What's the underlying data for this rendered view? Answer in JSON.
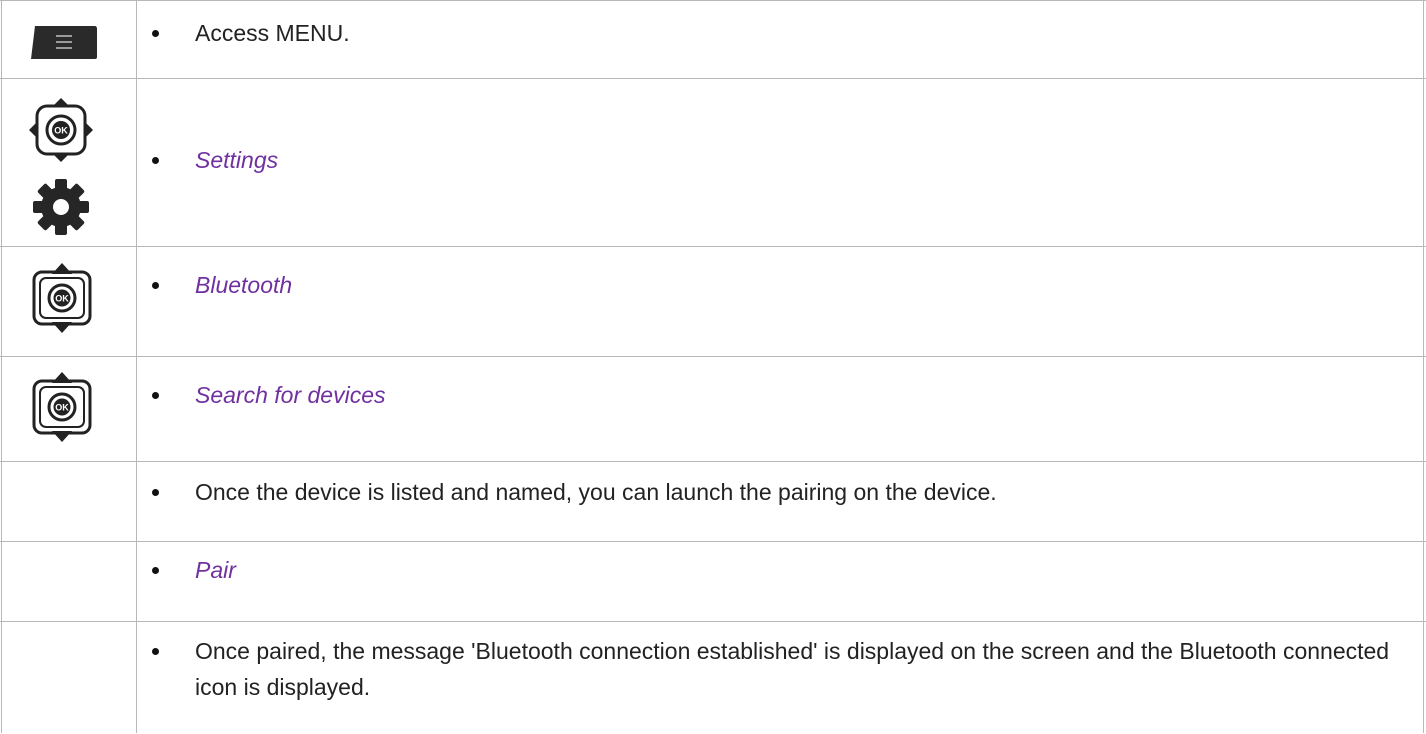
{
  "steps": [
    {
      "text": "Access MENU.",
      "icons": [
        "menu-key-icon"
      ],
      "italic": false
    },
    {
      "text": "Settings",
      "icons": [
        "navigator-4way-icon",
        "gear-icon"
      ],
      "italic": true
    },
    {
      "text": "Bluetooth",
      "icons": [
        "navigator-updown-icon"
      ],
      "italic": true
    },
    {
      "text": "Search for devices",
      "icons": [
        "navigator-updown-icon"
      ],
      "italic": true
    },
    {
      "text": "Once the device is listed and named, you can launch the pairing on the device.",
      "icons": [],
      "italic": false
    },
    {
      "text": "Pair",
      "icons": [],
      "italic": true
    },
    {
      "text": "Once paired, the message 'Bluetooth connection established' is displayed on the screen and the Bluetooth connected icon is displayed.",
      "icons": [],
      "italic": false
    }
  ],
  "ok_label": "OK",
  "colors": {
    "menu_text": "#7030a0",
    "border": "#b8b8b8"
  }
}
